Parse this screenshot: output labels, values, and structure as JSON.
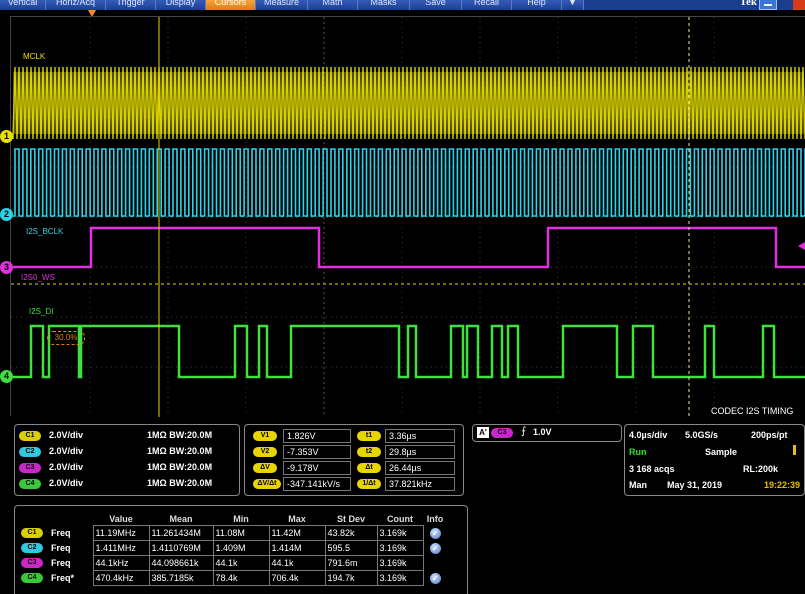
{
  "menu": {
    "items": [
      {
        "label": "Vertical",
        "active": false
      },
      {
        "label": "Horiz/Acq",
        "active": false
      },
      {
        "label": "Trigger",
        "active": false
      },
      {
        "label": "Display",
        "active": false
      },
      {
        "label": "Cursors",
        "active": true
      },
      {
        "label": "Measure",
        "active": false
      },
      {
        "label": "Math",
        "active": false
      },
      {
        "label": "Masks",
        "active": false
      },
      {
        "label": "Save",
        "active": false
      },
      {
        "label": "Recall",
        "active": false
      },
      {
        "label": "Help",
        "active": false
      },
      {
        "label": "▼",
        "active": false
      }
    ],
    "logo": "Tek"
  },
  "screen": {
    "channels": [
      {
        "id": "C1",
        "marker": "1",
        "label": "MCLK",
        "color": "#e8e000"
      },
      {
        "id": "C2",
        "marker": "2",
        "label": "I2S_BCLK",
        "color": "#2ad4e8"
      },
      {
        "id": "C3",
        "marker": "3",
        "label": "I2S0_WS",
        "color": "#e030e0"
      },
      {
        "id": "C4",
        "marker": "4",
        "label": "I2S_DI",
        "color": "#40e040"
      }
    ],
    "mask_percent": "30.0%",
    "title": "CODEC I2S TIMING"
  },
  "vertical": [
    {
      "pill": "C1",
      "scale": "2.0V/div",
      "impedance": "1MΩ BW:20.0M"
    },
    {
      "pill": "C2",
      "scale": "2.0V/div",
      "impedance": "1MΩ BW:20.0M"
    },
    {
      "pill": "C3",
      "scale": "2.0V/div",
      "impedance": "1MΩ BW:20.0M"
    },
    {
      "pill": "C4",
      "scale": "2.0V/div",
      "impedance": "1MΩ BW:20.0M"
    }
  ],
  "cursors": {
    "v1_label": "V1",
    "v1": "1.826V",
    "v2_label": "V2",
    "v2": "-7.353V",
    "dv_label": "ΔV",
    "dv": "-9.178V",
    "dvdt_label": "ΔV/Δt",
    "dvdt": "-347.141kV/s",
    "t1_label": "t1",
    "t1": "3.36µs",
    "t2_label": "t2",
    "t2": "29.8µs",
    "dt_label": "Δt",
    "dt": "26.44µs",
    "inv_label": "1/Δt",
    "inv": "37.821kHz"
  },
  "trigger": {
    "mode": "A'",
    "source": "C3",
    "slope": "⨍",
    "level": "1.0V"
  },
  "acquisition": {
    "timebase": "4.0µs/div",
    "sample_rate": "5.0GS/s",
    "resolution": "200ps/pt",
    "state": "Run",
    "mode": "Sample",
    "acqs": "3 168 acqs",
    "record_length": "RL:200k",
    "trig_mode": "Man",
    "date": "May 31, 2019",
    "time": "19:22:39"
  },
  "measurements": {
    "headers": [
      "",
      "",
      "Value",
      "Mean",
      "Min",
      "Max",
      "St Dev",
      "Count",
      "Info"
    ],
    "rows": [
      {
        "pill": "C1",
        "name": "Freq",
        "value": "11.19MHz",
        "mean": "11.261434M",
        "min": "11.08M",
        "max": "11.42M",
        "stdev": "43.82k",
        "count": "3.169k",
        "info": true
      },
      {
        "pill": "C2",
        "name": "Freq",
        "value": "1.411MHz",
        "mean": "1.4110769M",
        "min": "1.409M",
        "max": "1.414M",
        "stdev": "595.5",
        "count": "3.169k",
        "info": true
      },
      {
        "pill": "C3",
        "name": "Freq",
        "value": "44.1kHz",
        "mean": "44.098661k",
        "min": "44.1k",
        "max": "44.1k",
        "stdev": "791.6m",
        "count": "3.169k",
        "info": false
      },
      {
        "pill": "C4",
        "name": "Freq*",
        "value": "470.4kHz",
        "mean": "385.7185k",
        "min": "78.4k",
        "max": "706.4k",
        "stdev": "194.7k",
        "count": "3.169k",
        "info": true
      }
    ]
  },
  "colors": {
    "C1": "#e8e000",
    "C2": "#2ad4e8",
    "C3": "#e030e0",
    "C4": "#40e040",
    "C1_pill": "#d8d000",
    "C2_pill": "#30c8e0",
    "C3_pill": "#c828c8",
    "C4_pill": "#38c838",
    "run": "#30e030",
    "time": "#e8c000"
  }
}
